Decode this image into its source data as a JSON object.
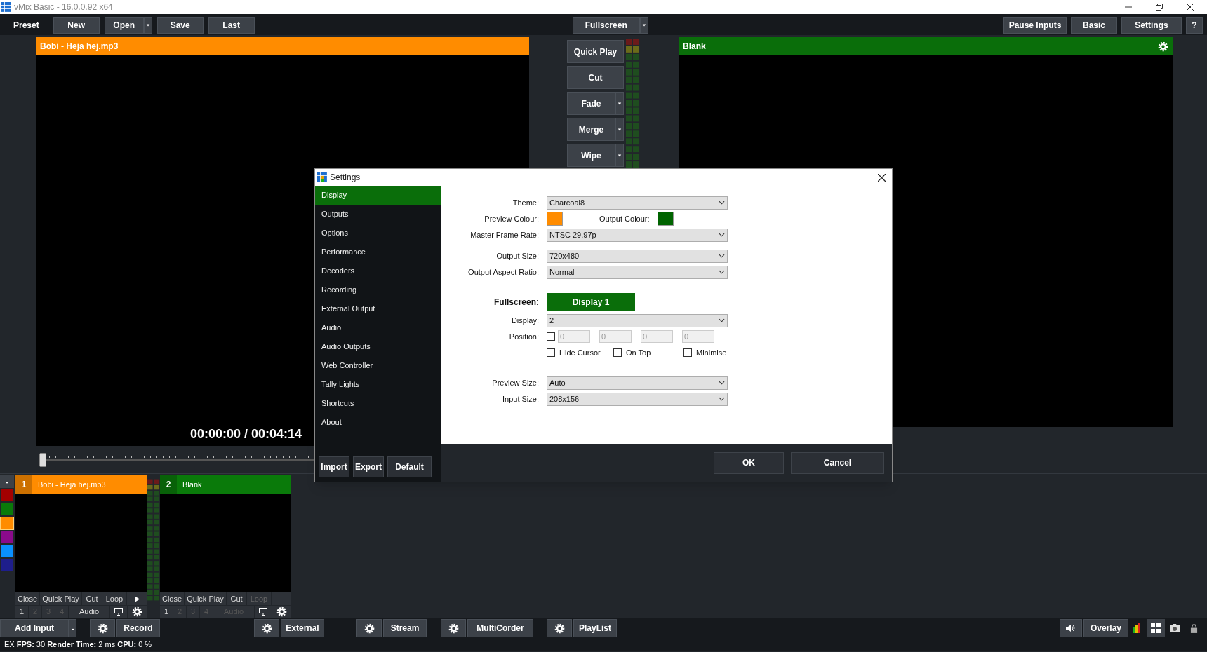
{
  "window": {
    "title": "vMix Basic - 16.0.0.92 x64"
  },
  "toolbar": {
    "preset_label": "Preset",
    "left_buttons": [
      {
        "label": "New",
        "dropdown": false
      },
      {
        "label": "Open",
        "dropdown": true
      },
      {
        "label": "Save",
        "dropdown": false
      },
      {
        "label": "Last",
        "dropdown": false
      }
    ],
    "center_buttons": [
      {
        "label": "Fullscreen",
        "dropdown": true
      }
    ],
    "right_buttons": [
      {
        "label": "Pause Inputs"
      },
      {
        "label": "Basic"
      },
      {
        "label": "Settings"
      },
      {
        "label": "?"
      }
    ]
  },
  "preview": {
    "title": "Bobi - Heja hej.mp3",
    "timecode": "00:00:00 / 00:04:14",
    "seek": {
      "level": 0
    }
  },
  "transitions": [
    {
      "label": "Quick Play",
      "dropdown": false
    },
    {
      "label": "Cut",
      "dropdown": false
    },
    {
      "label": "Fade",
      "dropdown": true
    },
    {
      "label": "Merge",
      "dropdown": true
    },
    {
      "label": "Wipe",
      "dropdown": true
    }
  ],
  "output": {
    "title": "Blank"
  },
  "collapse_button": "-",
  "color_filters": [
    {
      "color": "#a30000",
      "selected": false
    },
    {
      "color": "#0a7a0a",
      "selected": false
    },
    {
      "color": "#ff8c00",
      "selected": true
    },
    {
      "color": "#8b0a8b",
      "selected": false
    },
    {
      "color": "#0a90ff",
      "selected": false
    },
    {
      "color": "#1e1e8c",
      "selected": false
    }
  ],
  "inputs": [
    {
      "number": "1",
      "title": "Bobi - Heja hej.mp3",
      "color": "#ff8c00",
      "controls": [
        {
          "label": "Close",
          "disabled": false
        },
        {
          "label": "Quick Play",
          "disabled": false
        },
        {
          "label": "Cut",
          "disabled": false
        },
        {
          "label": "Loop",
          "disabled": false
        }
      ],
      "play_button": true,
      "buses": [
        {
          "label": "1",
          "on": true
        },
        {
          "label": "2",
          "on": false
        },
        {
          "label": "3",
          "on": false
        },
        {
          "label": "4",
          "on": false
        }
      ],
      "audio": {
        "label": "Audio",
        "disabled": false
      }
    },
    {
      "number": "2",
      "title": "Blank",
      "color": "#0a7a0a",
      "controls": [
        {
          "label": "Close",
          "disabled": false
        },
        {
          "label": "Quick Play",
          "disabled": false
        },
        {
          "label": "Cut",
          "disabled": false
        },
        {
          "label": "Loop",
          "disabled": true
        }
      ],
      "play_button": false,
      "buses": [
        {
          "label": "1",
          "on": true
        },
        {
          "label": "2",
          "on": false
        },
        {
          "label": "3",
          "on": false
        },
        {
          "label": "4",
          "on": false
        }
      ],
      "audio": {
        "label": "Audio",
        "disabled": true
      }
    }
  ],
  "bottom_bar": {
    "add_input": "Add Input",
    "add_input_menu": "-",
    "buttons": [
      {
        "label": "Record"
      },
      {
        "label": "External"
      },
      {
        "label": "Stream"
      },
      {
        "label": "MultiCorder"
      },
      {
        "label": "PlayList"
      }
    ],
    "overlay": "Overlay"
  },
  "status_bar": "EX **FPS:** 30 **Render Time:** 2 ms **CPU:** 0 %",
  "settings_dialog": {
    "title": "Settings",
    "nav": [
      {
        "label": "Display",
        "selected": true
      },
      {
        "label": "Outputs",
        "selected": false
      },
      {
        "label": "Options",
        "selected": false
      },
      {
        "label": "Performance",
        "selected": false
      },
      {
        "label": "Decoders",
        "selected": false
      },
      {
        "label": "Recording",
        "selected": false
      },
      {
        "label": "External Output",
        "selected": false
      },
      {
        "label": "Audio",
        "selected": false
      },
      {
        "label": "Audio Outputs",
        "selected": false
      },
      {
        "label": "Web Controller",
        "selected": false
      },
      {
        "label": "Tally Lights",
        "selected": false
      },
      {
        "label": "Shortcuts",
        "selected": false
      },
      {
        "label": "About",
        "selected": false
      }
    ],
    "nav_buttons": [
      "Import",
      "Export",
      "Default"
    ],
    "groups": [
      [
        {
          "kind": "select",
          "label": "Theme:",
          "value": "Charcoal8"
        },
        {
          "kind": "colors",
          "items": [
            {
              "label": "Preview Colour:",
              "color": "#ff8c00"
            },
            {
              "label": "Output Colour:",
              "color": "#006400"
            }
          ]
        },
        {
          "kind": "select",
          "label": "Master Frame Rate:",
          "value": "NTSC 29.97p"
        }
      ],
      [
        {
          "kind": "select",
          "label": "Output Size:",
          "value": "720x480"
        },
        {
          "kind": "select",
          "label": "Output Aspect Ratio:",
          "value": "Normal"
        }
      ],
      [
        {
          "kind": "button",
          "label": "Fullscreen:",
          "value": "Display 1"
        },
        {
          "kind": "select",
          "label": "Display:",
          "value": "2"
        },
        {
          "kind": "position",
          "label": "Position:",
          "checked": false,
          "values": [
            {
              "value": "0",
              "disabled": true
            },
            {
              "value": "0",
              "disabled": true
            },
            {
              "value": "0",
              "disabled": true
            },
            {
              "value": "0",
              "disabled": true
            }
          ]
        },
        {
          "kind": "checkboxes",
          "items": [
            {
              "label": "Hide Cursor",
              "checked": false
            },
            {
              "label": "On Top",
              "checked": false
            },
            {
              "label": "Minimise",
              "checked": false
            }
          ]
        }
      ],
      [
        {
          "kind": "select",
          "label": "Preview Size:",
          "value": "Auto"
        },
        {
          "kind": "select",
          "label": "Input Size:",
          "value": "208x156"
        }
      ]
    ],
    "buttons": [
      "OK",
      "Cancel"
    ]
  }
}
